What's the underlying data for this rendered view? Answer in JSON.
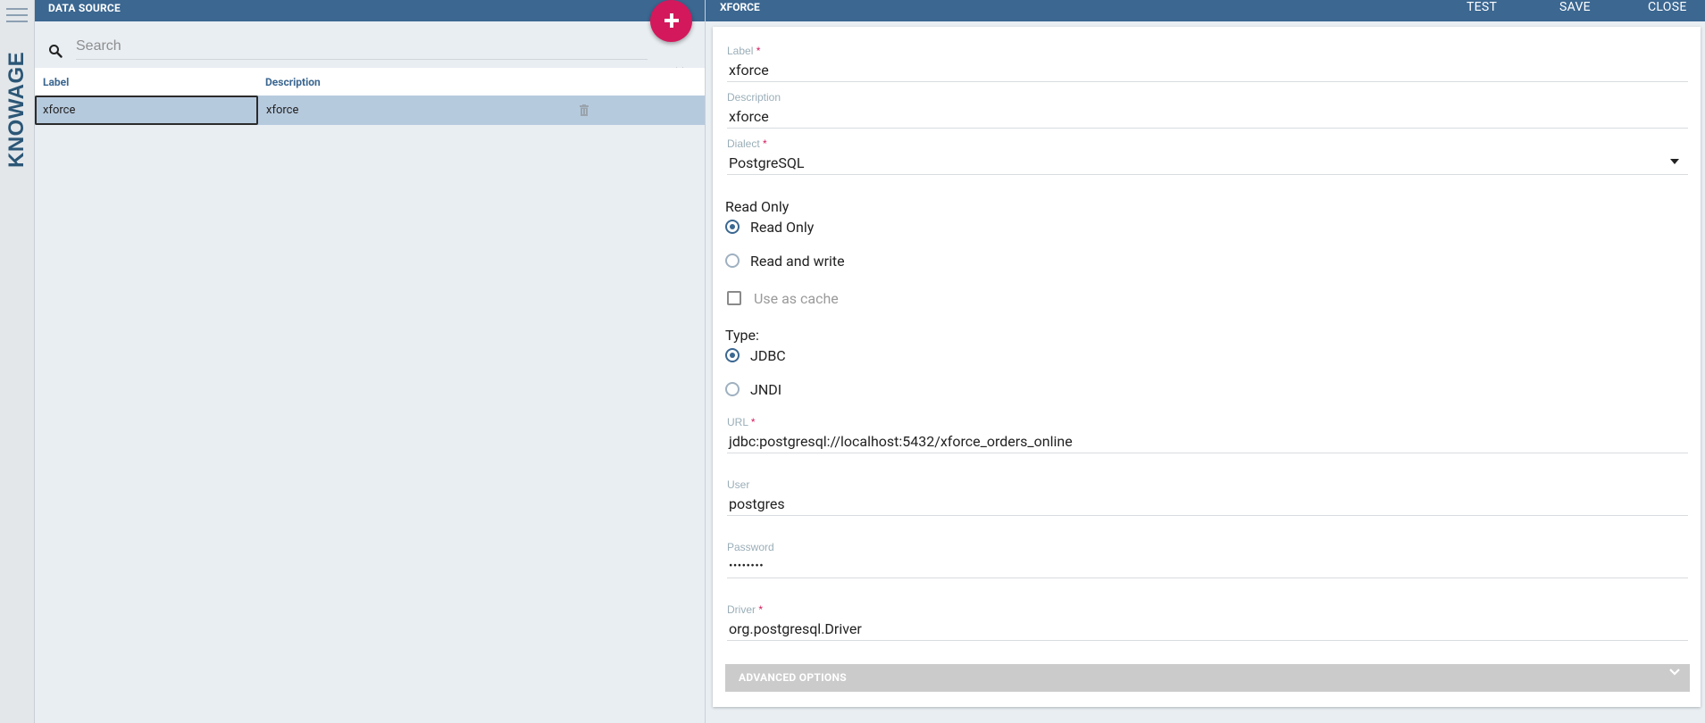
{
  "app": {
    "brand": "KNOWAGE",
    "menu_icon": "hamburger-icon"
  },
  "left_panel": {
    "title": "DATA SOURCE",
    "add_icon": "plus-icon",
    "search": {
      "placeholder": "Search",
      "value": "",
      "icon": "search-icon",
      "clear_icon": "close-icon"
    },
    "table": {
      "columns": [
        "Label",
        "Description"
      ],
      "rows": [
        {
          "label": "xforce",
          "description": "xforce",
          "delete_icon": "trash-icon"
        }
      ]
    }
  },
  "detail": {
    "title": "XFORCE",
    "actions": {
      "test": "TEST",
      "save": "SAVE",
      "close": "CLOSE"
    },
    "label": {
      "caption": "Label",
      "required": "*",
      "value": "xforce"
    },
    "description": {
      "caption": "Description",
      "value": "xforce"
    },
    "dialect": {
      "caption": "Dialect",
      "required": "*",
      "value": "PostgreSQL"
    },
    "read_only": {
      "title": "Read Only",
      "options": [
        "Read Only",
        "Read and write"
      ],
      "selected": "Read Only"
    },
    "use_as_cache": {
      "label": "Use as cache",
      "checked": false
    },
    "type": {
      "title": "Type:",
      "options": [
        "JDBC",
        "JNDI"
      ],
      "selected": "JDBC"
    },
    "url": {
      "caption": "URL",
      "required": "*",
      "value": "jdbc:postgresql://localhost:5432/xforce_orders_online"
    },
    "user": {
      "caption": "User",
      "value": "postgres"
    },
    "password": {
      "caption": "Password",
      "value": "••••••••"
    },
    "driver": {
      "caption": "Driver",
      "required": "*",
      "value": "org.postgresql.Driver"
    },
    "advanced": {
      "label": "ADVANCED OPTIONS",
      "expanded": false
    }
  },
  "colors": {
    "header": "#3b6791",
    "accent": "#d4185c",
    "selected_row": "#b6cade",
    "background": "#e9eef3"
  }
}
